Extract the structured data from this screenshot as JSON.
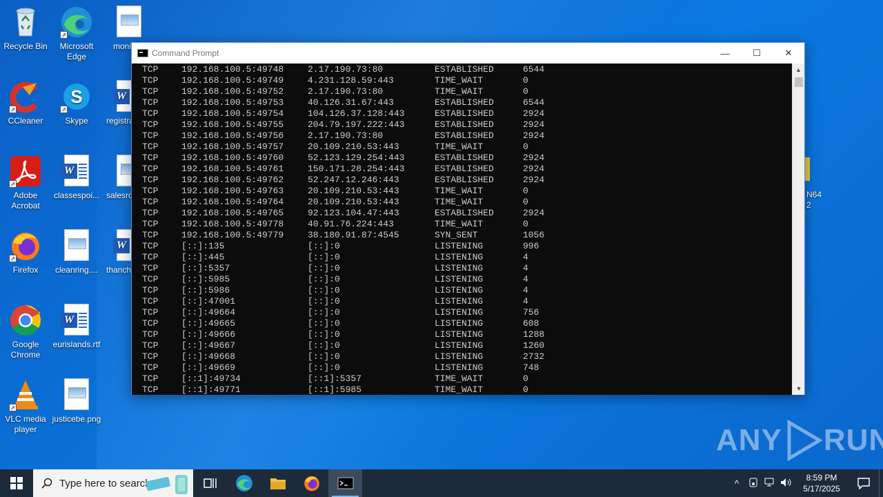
{
  "desktop": {
    "icons": [
      {
        "label": "Recycle Bin",
        "icon": "recycle-bin-icon"
      },
      {
        "label": "Microsoft Edge",
        "icon": "edge-icon"
      },
      {
        "label": "monit",
        "icon": "image-file-icon"
      },
      {
        "label": "CCleaner",
        "icon": "ccleaner-icon"
      },
      {
        "label": "Skype",
        "icon": "skype-icon"
      },
      {
        "label": "registra",
        "icon": "word-doc-icon"
      },
      {
        "label": "Adobe Acrobat",
        "icon": "acrobat-icon"
      },
      {
        "label": "classespoi...",
        "icon": "word-doc-icon"
      },
      {
        "label": "salesro",
        "icon": "image-file-icon"
      },
      {
        "label": "Firefox",
        "icon": "firefox-icon"
      },
      {
        "label": "cleanring....",
        "icon": "image-file-icon"
      },
      {
        "label": "thanch",
        "icon": "word-doc-icon"
      },
      {
        "label": "Google Chrome",
        "icon": "chrome-icon"
      },
      {
        "label": "eurislands.rtf",
        "icon": "word-doc-icon"
      },
      {
        "label": "VLC media player",
        "icon": "vlc-icon"
      },
      {
        "label": "justicebe.png",
        "icon": "image-file-icon"
      }
    ],
    "partial_right_label_1": "N64",
    "partial_right_label_2": "2"
  },
  "window": {
    "title": "Command Prompt",
    "minimize": "—",
    "maximize": "☐",
    "close": "✕"
  },
  "netstat_rows": [
    [
      "TCP",
      "192.168.100.5:49748",
      "2.17.190.73:80",
      "ESTABLISHED",
      "6544"
    ],
    [
      "TCP",
      "192.168.100.5:49749",
      "4.231.128.59:443",
      "TIME_WAIT",
      "0"
    ],
    [
      "TCP",
      "192.168.100.5:49752",
      "2.17.190.73:80",
      "TIME_WAIT",
      "0"
    ],
    [
      "TCP",
      "192.168.100.5:49753",
      "40.126.31.67:443",
      "ESTABLISHED",
      "6544"
    ],
    [
      "TCP",
      "192.168.100.5:49754",
      "104.126.37.128:443",
      "ESTABLISHED",
      "2924"
    ],
    [
      "TCP",
      "192.168.100.5:49755",
      "204.79.197.222:443",
      "ESTABLISHED",
      "2924"
    ],
    [
      "TCP",
      "192.168.100.5:49756",
      "2.17.190.73:80",
      "ESTABLISHED",
      "2924"
    ],
    [
      "TCP",
      "192.168.100.5:49757",
      "20.109.210.53:443",
      "TIME_WAIT",
      "0"
    ],
    [
      "TCP",
      "192.168.100.5:49760",
      "52.123.129.254:443",
      "ESTABLISHED",
      "2924"
    ],
    [
      "TCP",
      "192.168.100.5:49761",
      "150.171.28.254:443",
      "ESTABLISHED",
      "2924"
    ],
    [
      "TCP",
      "192.168.100.5:49762",
      "52.247.12.246:443",
      "ESTABLISHED",
      "2924"
    ],
    [
      "TCP",
      "192.168.100.5:49763",
      "20.109.210.53:443",
      "TIME_WAIT",
      "0"
    ],
    [
      "TCP",
      "192.168.100.5:49764",
      "20.109.210.53:443",
      "TIME_WAIT",
      "0"
    ],
    [
      "TCP",
      "192.168.100.5:49765",
      "92.123.104.47:443",
      "ESTABLISHED",
      "2924"
    ],
    [
      "TCP",
      "192.168.100.5:49778",
      "40.91.76.224:443",
      "TIME_WAIT",
      "0"
    ],
    [
      "TCP",
      "192.168.100.5:49779",
      "38.180.91.87:4545",
      "SYN_SENT",
      "1056"
    ],
    [
      "TCP",
      "[::]:135",
      "[::]:0",
      "LISTENING",
      "996"
    ],
    [
      "TCP",
      "[::]:445",
      "[::]:0",
      "LISTENING",
      "4"
    ],
    [
      "TCP",
      "[::]:5357",
      "[::]:0",
      "LISTENING",
      "4"
    ],
    [
      "TCP",
      "[::]:5985",
      "[::]:0",
      "LISTENING",
      "4"
    ],
    [
      "TCP",
      "[::]:5986",
      "[::]:0",
      "LISTENING",
      "4"
    ],
    [
      "TCP",
      "[::]:47001",
      "[::]:0",
      "LISTENING",
      "4"
    ],
    [
      "TCP",
      "[::]:49664",
      "[::]:0",
      "LISTENING",
      "756"
    ],
    [
      "TCP",
      "[::]:49665",
      "[::]:0",
      "LISTENING",
      "608"
    ],
    [
      "TCP",
      "[::]:49666",
      "[::]:0",
      "LISTENING",
      "1288"
    ],
    [
      "TCP",
      "[::]:49667",
      "[::]:0",
      "LISTENING",
      "1260"
    ],
    [
      "TCP",
      "[::]:49668",
      "[::]:0",
      "LISTENING",
      "2732"
    ],
    [
      "TCP",
      "[::]:49669",
      "[::]:0",
      "LISTENING",
      "748"
    ],
    [
      "TCP",
      "[::1]:49734",
      "[::1]:5357",
      "TIME_WAIT",
      "0"
    ],
    [
      "TCP",
      "[::1]:49771",
      "[::1]:5985",
      "TIME_WAIT",
      "0"
    ]
  ],
  "watermark": {
    "left": "ANY",
    "right": "RUN"
  },
  "taskbar": {
    "search_placeholder": "Type here to search",
    "pinned": [
      "task-view-icon",
      "edge-icon",
      "file-explorer-icon",
      "firefox-icon",
      "command-prompt-icon"
    ],
    "clock_time": "8:59 PM",
    "clock_date": "5/17/2025"
  },
  "colors": {
    "console_bg": "#0c0c0c",
    "console_text": "#cccccc",
    "taskbar_bg": "#1c2a3a",
    "desktop_blue": "#0a78e0"
  }
}
